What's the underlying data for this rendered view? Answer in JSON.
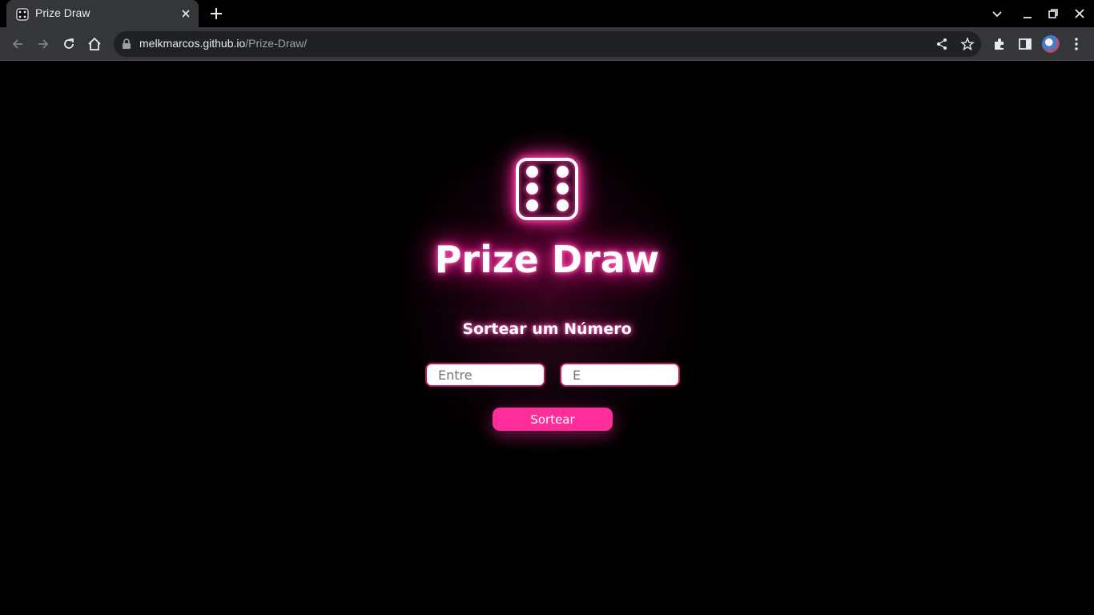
{
  "browser": {
    "tab_title": "Prize Draw",
    "url_host": "melkmarcos.github.io",
    "url_path": "/Prize-Draw/"
  },
  "page": {
    "title": "Prize Draw",
    "subtitle": "Sortear um Número",
    "input_from_placeholder": "Entre",
    "input_to_placeholder": "E",
    "draw_button_label": "Sortear"
  },
  "colors": {
    "accent": "#ff2d9a",
    "background": "#000000",
    "input_border": "#c2185b"
  }
}
